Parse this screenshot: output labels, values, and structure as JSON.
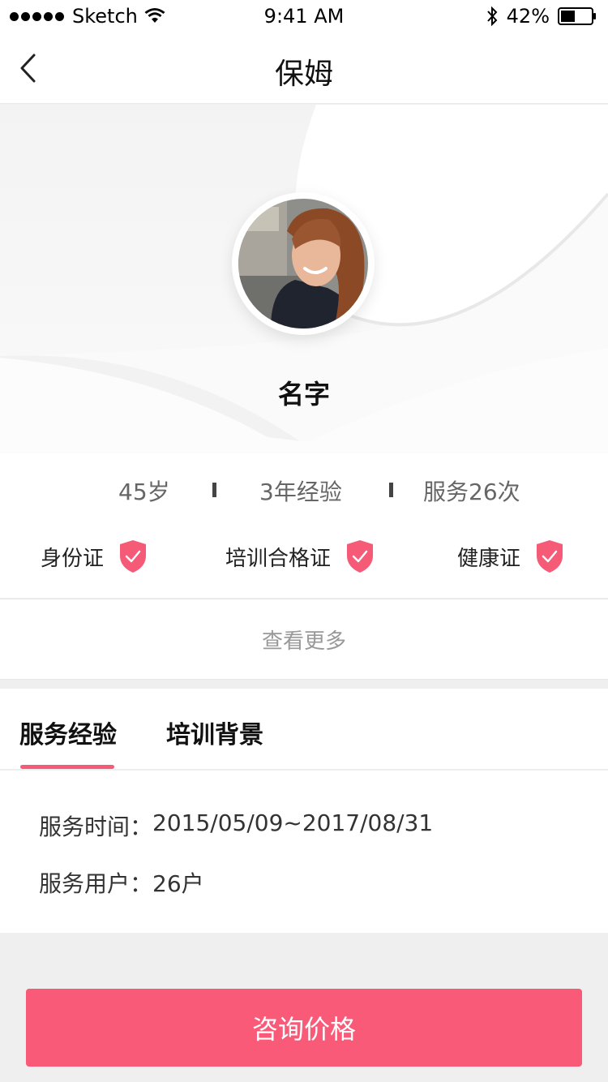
{
  "status_bar": {
    "carrier": "Sketch",
    "time": "9:41 AM",
    "battery": "42%"
  },
  "nav": {
    "title": "保姆",
    "back_icon": "chevron-left-icon"
  },
  "profile": {
    "name": "名字"
  },
  "stats": {
    "age": "45岁",
    "experience": "3年经验",
    "service_count": "服务26次"
  },
  "certificates": [
    {
      "label": "身份证",
      "icon": "shield-check-icon",
      "verified": true
    },
    {
      "label": "培训合格证",
      "icon": "shield-check-icon",
      "verified": true
    },
    {
      "label": "健康证",
      "icon": "shield-check-icon",
      "verified": true
    }
  ],
  "view_more": "查看更多",
  "tabs": [
    {
      "label": "服务经验",
      "active": true
    },
    {
      "label": "培训背景",
      "active": false
    }
  ],
  "service_info": {
    "time_label": "服务时间：",
    "time_value": "2015/05/09~2017/08/31",
    "users_label": "服务用户：",
    "users_value": "26户"
  },
  "cta": {
    "label": "咨询价格"
  },
  "colors": {
    "accent": "#f95a78",
    "shield": "#f55a76"
  }
}
